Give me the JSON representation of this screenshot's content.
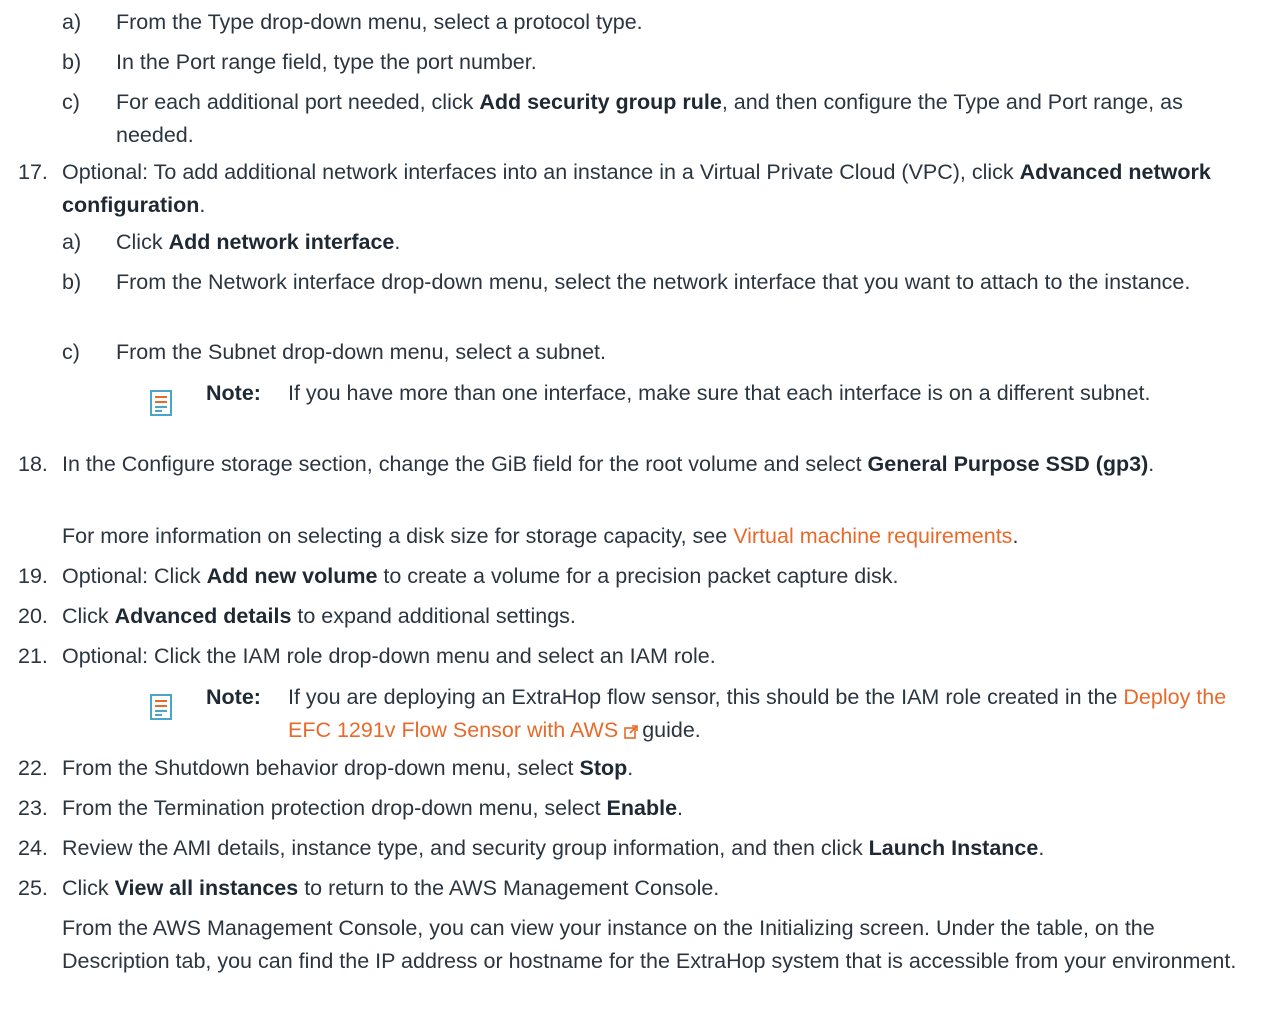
{
  "colors": {
    "text": "#2b3540",
    "link": "#e86a2a",
    "icon": "#4aa5c8"
  },
  "icons": {
    "note": "note-icon",
    "external": "external-link-icon"
  },
  "step16": {
    "a_marker": "a)",
    "a_text": "From the Type drop-down menu, select a protocol type.",
    "b_marker": "b)",
    "b_text": "In the Port range field, type the port number.",
    "c_marker": "c)",
    "c_pre": "For each additional port needed, click ",
    "c_bold": "Add security group rule",
    "c_post": ", and then configure the Type and Port range, as needed."
  },
  "step17": {
    "number": "17.",
    "pre": "Optional: To add additional network interfaces into an instance in a Virtual Private Cloud (VPC), click ",
    "bold": "Advanced network configuration",
    "post": ".",
    "a_marker": "a)",
    "a_pre": "Click ",
    "a_bold": "Add network interface",
    "a_post": ".",
    "b_marker": "b)",
    "b_text": "From the Network interface drop-down menu, select the network interface that you want to attach to the instance.",
    "c_marker": "c)",
    "c_text": "From the Subnet drop-down menu, select a subnet.",
    "note_label": "Note:",
    "note_text": "If you have more than one interface, make sure that each interface is on a different subnet."
  },
  "step18": {
    "number": "18.",
    "pre": "In the Configure storage section, change the GiB field for the root volume and select ",
    "bold": "General Purpose SSD (gp3)",
    "post": ".",
    "info_pre": "For more information on selecting a disk size for storage capacity, see ",
    "info_link": "Virtual machine requirements",
    "info_post": "."
  },
  "step19": {
    "number": "19.",
    "pre": "Optional: Click ",
    "bold": "Add new volume",
    "post": " to create a volume for a precision packet capture disk."
  },
  "step20": {
    "number": "20.",
    "pre": "Click ",
    "bold": "Advanced details",
    "post": " to expand additional settings."
  },
  "step21": {
    "number": "21.",
    "text": "Optional: Click the IAM role drop-down menu and select an IAM role.",
    "note_label": "Note:",
    "note_text": "If you are deploying an ExtraHop flow sensor, this should be the IAM role created in the ",
    "note_link": "Deploy the EFC 1291v Flow Sensor with AWS",
    "note_post": "guide."
  },
  "step22": {
    "number": "22.",
    "pre": "From the Shutdown behavior drop-down menu, select ",
    "bold": "Stop",
    "post": "."
  },
  "step23": {
    "number": "23.",
    "pre": "From the Termination protection drop-down menu, select ",
    "bold": "Enable",
    "post": "."
  },
  "step24": {
    "number": "24.",
    "pre": "Review the AMI details, instance type, and security group information, and then click ",
    "bold": "Launch Instance",
    "post": "."
  },
  "step25": {
    "number": "25.",
    "pre": "Click ",
    "bold": "View all instances",
    "post": " to return to the AWS Management Console.",
    "info": "From the AWS Management Console, you can view your instance on the Initializing screen. Under the table, on the Description tab, you can find the IP address or hostname for the ExtraHop system that is accessible from your environment."
  }
}
